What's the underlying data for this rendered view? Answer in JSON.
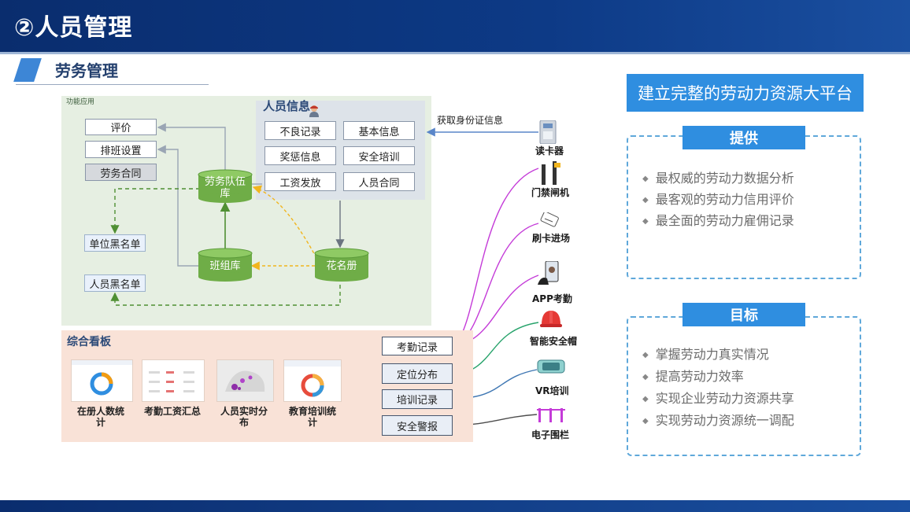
{
  "header": {
    "title": "②人员管理"
  },
  "section": {
    "title": "劳务管理"
  },
  "function_panel": {
    "label": "功能应用",
    "left_items": [
      "评价",
      "排班设置",
      "劳务合同"
    ],
    "blacklists": [
      "单位黑名单",
      "人员黑名单"
    ],
    "databases": [
      "劳务队伍\n库",
      "班组库",
      "花名册"
    ]
  },
  "person_info": {
    "title": "人员信息",
    "items": [
      "不良记录",
      "基本信息",
      "奖惩信息",
      "安全培训",
      "工资发放",
      "人员合同"
    ]
  },
  "id_card_label": "获取身份证信息",
  "dashboard": {
    "title": "综合看板",
    "thumbnails": [
      "在册人数统\n计",
      "考勤工资汇总",
      "人员实时分\n布",
      "教育培训统\n计"
    ],
    "records": [
      "考勤记录",
      "定位分布",
      "培训记录",
      "安全警报"
    ]
  },
  "devices": [
    "读卡器",
    "门禁闸机",
    "刷卡进场",
    "APP考勤",
    "智能安全帽",
    "VR培训",
    "电子围栏"
  ],
  "platform": {
    "title": "建立完整的劳动力资源大平台",
    "provide": {
      "heading": "提供",
      "items": [
        "最权威的劳动力数据分析",
        "最客观的劳动力信用评价",
        "最全面的劳动力雇佣记录"
      ]
    },
    "goal": {
      "heading": "目标",
      "items": [
        "掌握劳动力真实情况",
        "提高劳动力效率",
        "实现企业劳动力资源共享",
        "实现劳动力资源统一调配"
      ]
    }
  },
  "colors": {
    "header": "#0d3a86",
    "accent": "#2f8ee0",
    "cylinder": "#6fad47",
    "function_bg": "#e6efe2",
    "dashboard_bg": "#f9e2d7"
  }
}
